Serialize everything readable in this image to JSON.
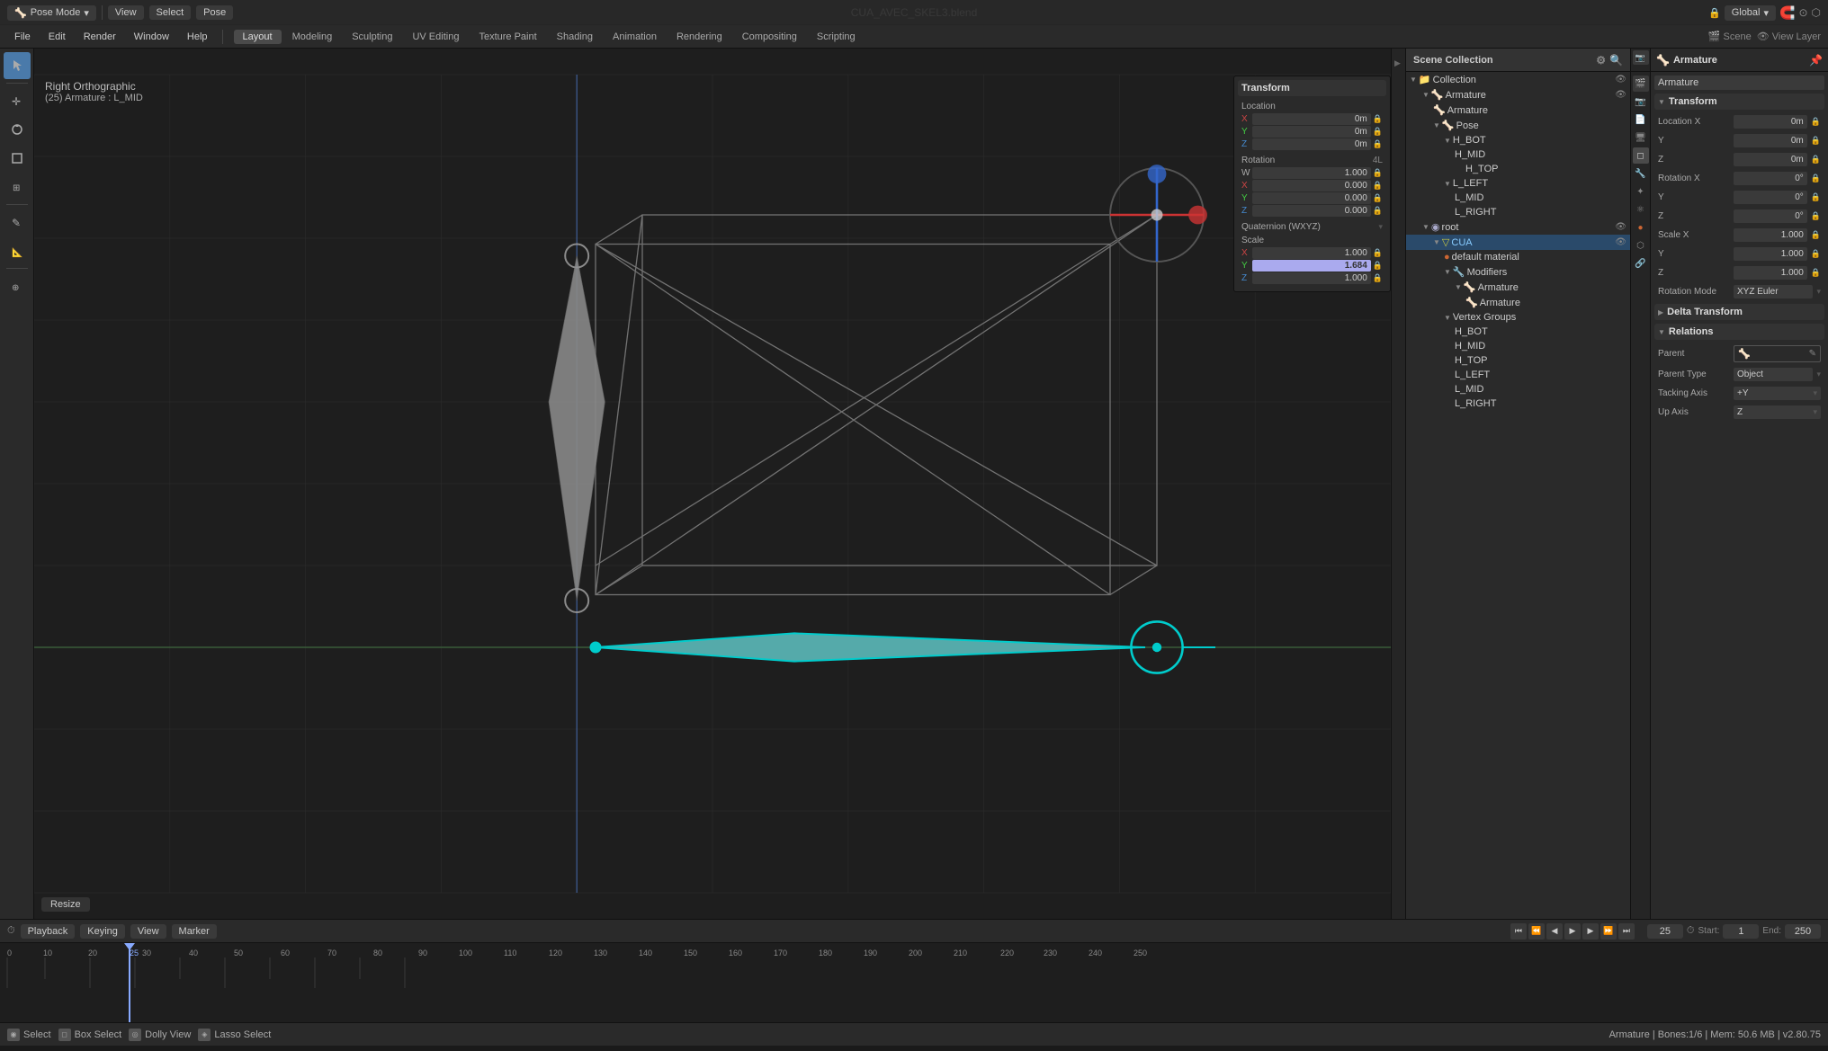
{
  "window": {
    "title": "CUA_AVEC_SKEL3.blend",
    "controls": {
      "close": "●",
      "minimize": "●",
      "maximize": "●"
    }
  },
  "menubar": {
    "items": [
      "File",
      "Edit",
      "Render",
      "Window",
      "Help"
    ],
    "active_tab": "Layout",
    "tabs": [
      "Layout",
      "Modeling",
      "Sculpting",
      "UV Editing",
      "Texture Paint",
      "Shading",
      "Animation",
      "Rendering",
      "Compositing",
      "Scripting"
    ]
  },
  "viewport": {
    "mode": "Pose Mode",
    "select_label": "Select",
    "view_label": "View",
    "pose_label": "Pose",
    "orientation": "Global",
    "view_type": "Right Orthographic",
    "object_name": "(25) Armature : L_MID",
    "frame_current": "25",
    "frame_start": "1",
    "frame_end": "250"
  },
  "transform_panel": {
    "title": "Transform",
    "location_label": "Location",
    "x": "0m",
    "y": "0m",
    "z": "0m",
    "rotation_label": "Rotation",
    "rot_mode": "4L",
    "rot_w": "1.000",
    "rot_x": "0.000",
    "rot_y": "0.000",
    "rot_z": "0.000",
    "quaternion_label": "Quaternion (WXYZ)",
    "scale_label": "Scale",
    "scale_x": "1.000",
    "scale_y": "1.684",
    "scale_z": "1.000"
  },
  "outliner": {
    "title": "Scene Collection",
    "items": [
      {
        "label": "Collection",
        "indent": 0,
        "icon": "📁",
        "has_eye": true,
        "expanded": true
      },
      {
        "label": "Armature",
        "indent": 1,
        "icon": "🦴",
        "has_eye": true,
        "expanded": true
      },
      {
        "label": "Armature",
        "indent": 2,
        "icon": "🦴",
        "has_eye": false
      },
      {
        "label": "Pose",
        "indent": 2,
        "icon": "🦴",
        "has_eye": false,
        "expanded": true
      },
      {
        "label": "H_BOT",
        "indent": 3,
        "icon": "🦴",
        "has_eye": false,
        "expanded": true
      },
      {
        "label": "H_MID",
        "indent": 4,
        "icon": "🦴",
        "has_eye": false
      },
      {
        "label": "H_TOP",
        "indent": 5,
        "icon": "🦴",
        "has_eye": false
      },
      {
        "label": "L_LEFT",
        "indent": 3,
        "icon": "🦴",
        "has_eye": false,
        "expanded": true
      },
      {
        "label": "L_MID",
        "indent": 4,
        "icon": "🦴",
        "has_eye": false
      },
      {
        "label": "L_RIGHT",
        "indent": 4,
        "icon": "🦴",
        "has_eye": false
      },
      {
        "label": "root",
        "indent": 1,
        "icon": "🦴",
        "has_eye": true,
        "expanded": true
      },
      {
        "label": "CUA",
        "indent": 2,
        "icon": "▼",
        "has_eye": true,
        "selected": true,
        "expanded": true
      },
      {
        "label": "default material",
        "indent": 3,
        "icon": "●",
        "has_eye": false
      },
      {
        "label": "Modifiers",
        "indent": 3,
        "icon": "🔧",
        "has_eye": false,
        "expanded": true
      },
      {
        "label": "Armature",
        "indent": 4,
        "icon": "🦴",
        "has_eye": false,
        "expanded": true
      },
      {
        "label": "Armature",
        "indent": 5,
        "icon": "🦴",
        "has_eye": false
      },
      {
        "label": "Vertex Groups",
        "indent": 3,
        "icon": "▼",
        "has_eye": false,
        "expanded": true
      },
      {
        "label": "H_BOT",
        "indent": 4,
        "icon": "",
        "has_eye": false
      },
      {
        "label": "H_MID",
        "indent": 4,
        "icon": "",
        "has_eye": false
      },
      {
        "label": "H_TOP",
        "indent": 4,
        "icon": "",
        "has_eye": false
      },
      {
        "label": "L_LEFT",
        "indent": 4,
        "icon": "",
        "has_eye": false
      },
      {
        "label": "L_MID",
        "indent": 4,
        "icon": "",
        "has_eye": false
      },
      {
        "label": "L_RIGHT",
        "indent": 4,
        "icon": "",
        "has_eye": false
      }
    ]
  },
  "object_props": {
    "title": "Armature",
    "name_value": "Armature",
    "transform_section": "Transform",
    "location": {
      "x_label": "Location X",
      "x_val": "0m",
      "y_label": "Y",
      "y_val": "0m",
      "z_label": "Z",
      "z_val": "0m"
    },
    "rotation": {
      "x_label": "Rotation X",
      "x_val": "0°",
      "y_label": "Y",
      "y_val": "0°",
      "z_label": "Z",
      "z_val": "0°"
    },
    "scale": {
      "x_label": "Scale X",
      "x_val": "1.000",
      "y_label": "Y",
      "y_val": "1.000",
      "z_label": "Z",
      "z_val": "1.000"
    },
    "rotation_mode_label": "Rotation Mode",
    "rotation_mode_val": "XYZ Euler",
    "delta_transform": "Delta Transform",
    "relations": "Relations",
    "parent_label": "Parent",
    "parent_val": "",
    "parent_type_label": "Parent Type",
    "parent_type_val": "Object",
    "tracking_axis_label": "Tacking Axis",
    "tracking_axis_val": "+Y",
    "up_axis_label": "Up Axis",
    "up_axis_val": "Z"
  },
  "timeline": {
    "playback": "Playback",
    "keying": "Keying",
    "view_label": "View",
    "marker_label": "Marker",
    "frame_current": "25",
    "frame_start": "1",
    "frame_end": "250",
    "markers": [
      0,
      10,
      20,
      30,
      40,
      50,
      60,
      70,
      80,
      90,
      100,
      110,
      120,
      130,
      140,
      150,
      160,
      170,
      180,
      190,
      200,
      210,
      220,
      230,
      240,
      250
    ]
  },
  "status_bar": {
    "items": [
      {
        "icon": "◉",
        "label": "Select"
      },
      {
        "icon": "◻",
        "label": "Box Select"
      },
      {
        "icon": "◎",
        "label": "Dolly View"
      },
      {
        "icon": "◈",
        "label": "Lasso Select"
      }
    ],
    "info": "Armature | Bones:1/6 | Mem: 50.6 MB | v2.80.75"
  },
  "resize_button": "Resize",
  "colors": {
    "accent": "#4a7aaa",
    "selected_bone": "#00cccc",
    "background": "#1e1e1e",
    "panel_bg": "#2a2a2a",
    "header_bg": "#333333"
  }
}
